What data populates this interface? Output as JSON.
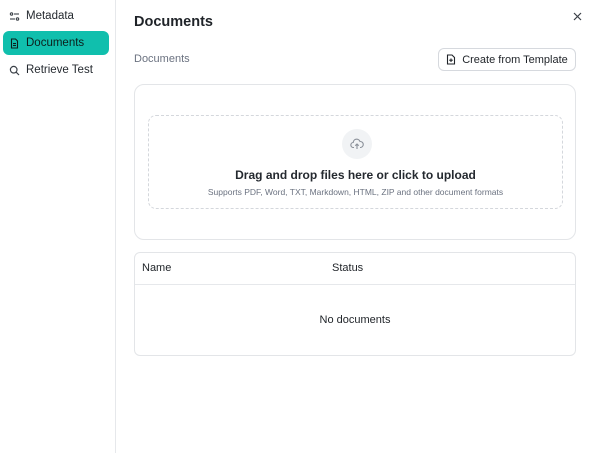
{
  "sidebar": {
    "items": [
      {
        "label": "Metadata",
        "icon": "metadata-icon",
        "active": false
      },
      {
        "label": "Documents",
        "icon": "document-icon",
        "active": true
      },
      {
        "label": "Retrieve Test",
        "icon": "search-icon",
        "active": false
      }
    ]
  },
  "header": {
    "title": "Documents",
    "close_icon": "close-icon"
  },
  "toolbar": {
    "section_label": "Documents",
    "template_button_label": "Create from Template",
    "template_button_icon": "file-plus-icon"
  },
  "upload": {
    "icon": "cloud-upload-icon",
    "title": "Drag and drop files here or click to upload",
    "subtitle": "Supports PDF, Word, TXT, Markdown, HTML, ZIP and other document formats"
  },
  "table": {
    "columns": [
      "Name",
      "Status"
    ],
    "empty_text": "No documents"
  },
  "colors": {
    "accent": "#10bfad",
    "border": "#e3e5e8",
    "muted_text": "#6b7280"
  }
}
